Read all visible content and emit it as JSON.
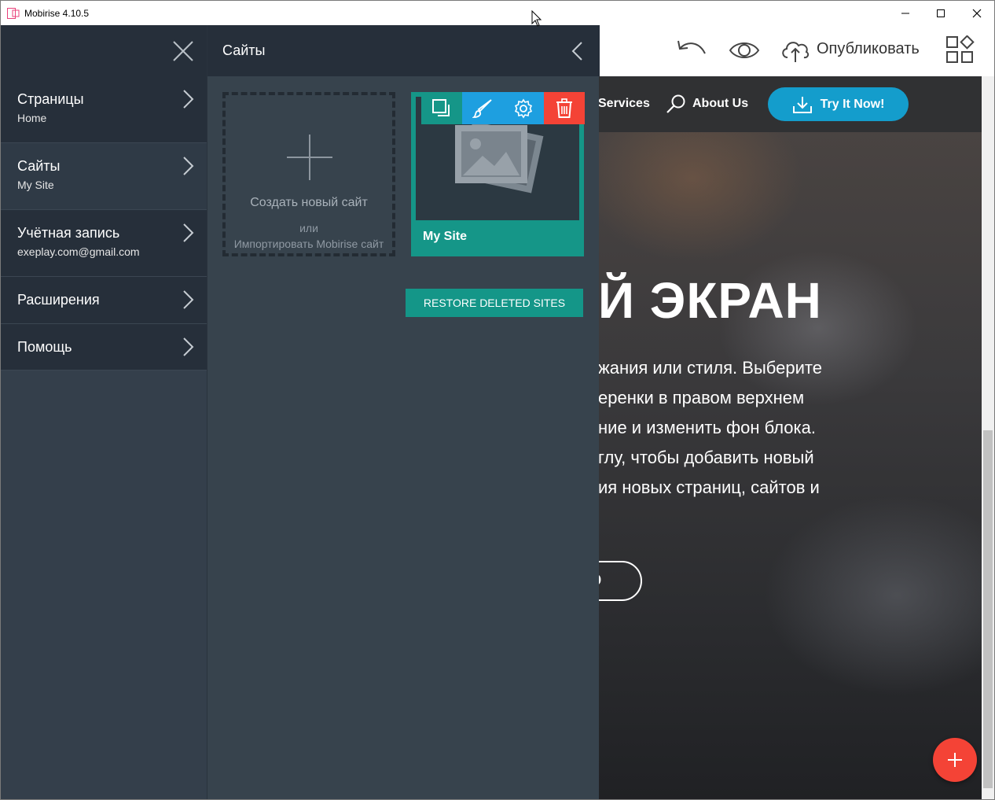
{
  "window": {
    "title": "Mobirise 4.10.5"
  },
  "toolbar": {
    "publish_label": "Опубликовать"
  },
  "preview": {
    "nav": {
      "services": "Services",
      "about": "About Us",
      "cta": "Try It Now!"
    },
    "hero_title": "Й ЭКРАН",
    "hero_lines": [
      "жания или стиля. Выберите",
      "еренки в правом верхнем",
      "ние и изменить фон блока.",
      "глу, чтобы добавить новый",
      "ия новых страниц, сайтов и"
    ],
    "button_fragment": "Э"
  },
  "menu": {
    "items": [
      {
        "title": "Страницы",
        "subtitle": "Home"
      },
      {
        "title": "Сайты",
        "subtitle": "My Site"
      },
      {
        "title": "Учётная запись",
        "subtitle": "exeplay.com@gmail.com"
      },
      {
        "title": "Расширения",
        "subtitle": ""
      },
      {
        "title": "Помощь",
        "subtitle": ""
      }
    ]
  },
  "panel": {
    "title": "Сайты",
    "new_site": {
      "create_label": "Создать новый сайт",
      "or_label": "или",
      "import_label": "Импортировать Mobirise сайт"
    },
    "site_card": {
      "name": "My Site"
    },
    "restore_label": "RESTORE DELETED SITES"
  },
  "colors": {
    "menu_bg": "#262f3a",
    "panel_bg": "#37434d",
    "teal": "#159688",
    "cta_blue": "#149dcc",
    "delete_red": "#f44336",
    "brush_blue": "#1e9fe0"
  },
  "icons": [
    "app-icon",
    "minimize-icon",
    "maximize-icon",
    "close-icon",
    "undo-icon",
    "eye-icon",
    "cloud-upload-icon",
    "blocks-icon",
    "menu-close-icon",
    "chevron-right-icon",
    "chevron-left-icon",
    "plus-icon",
    "image-icon",
    "duplicate-icon",
    "brush-icon",
    "gear-icon",
    "trash-icon",
    "search-icon",
    "download-icon"
  ]
}
